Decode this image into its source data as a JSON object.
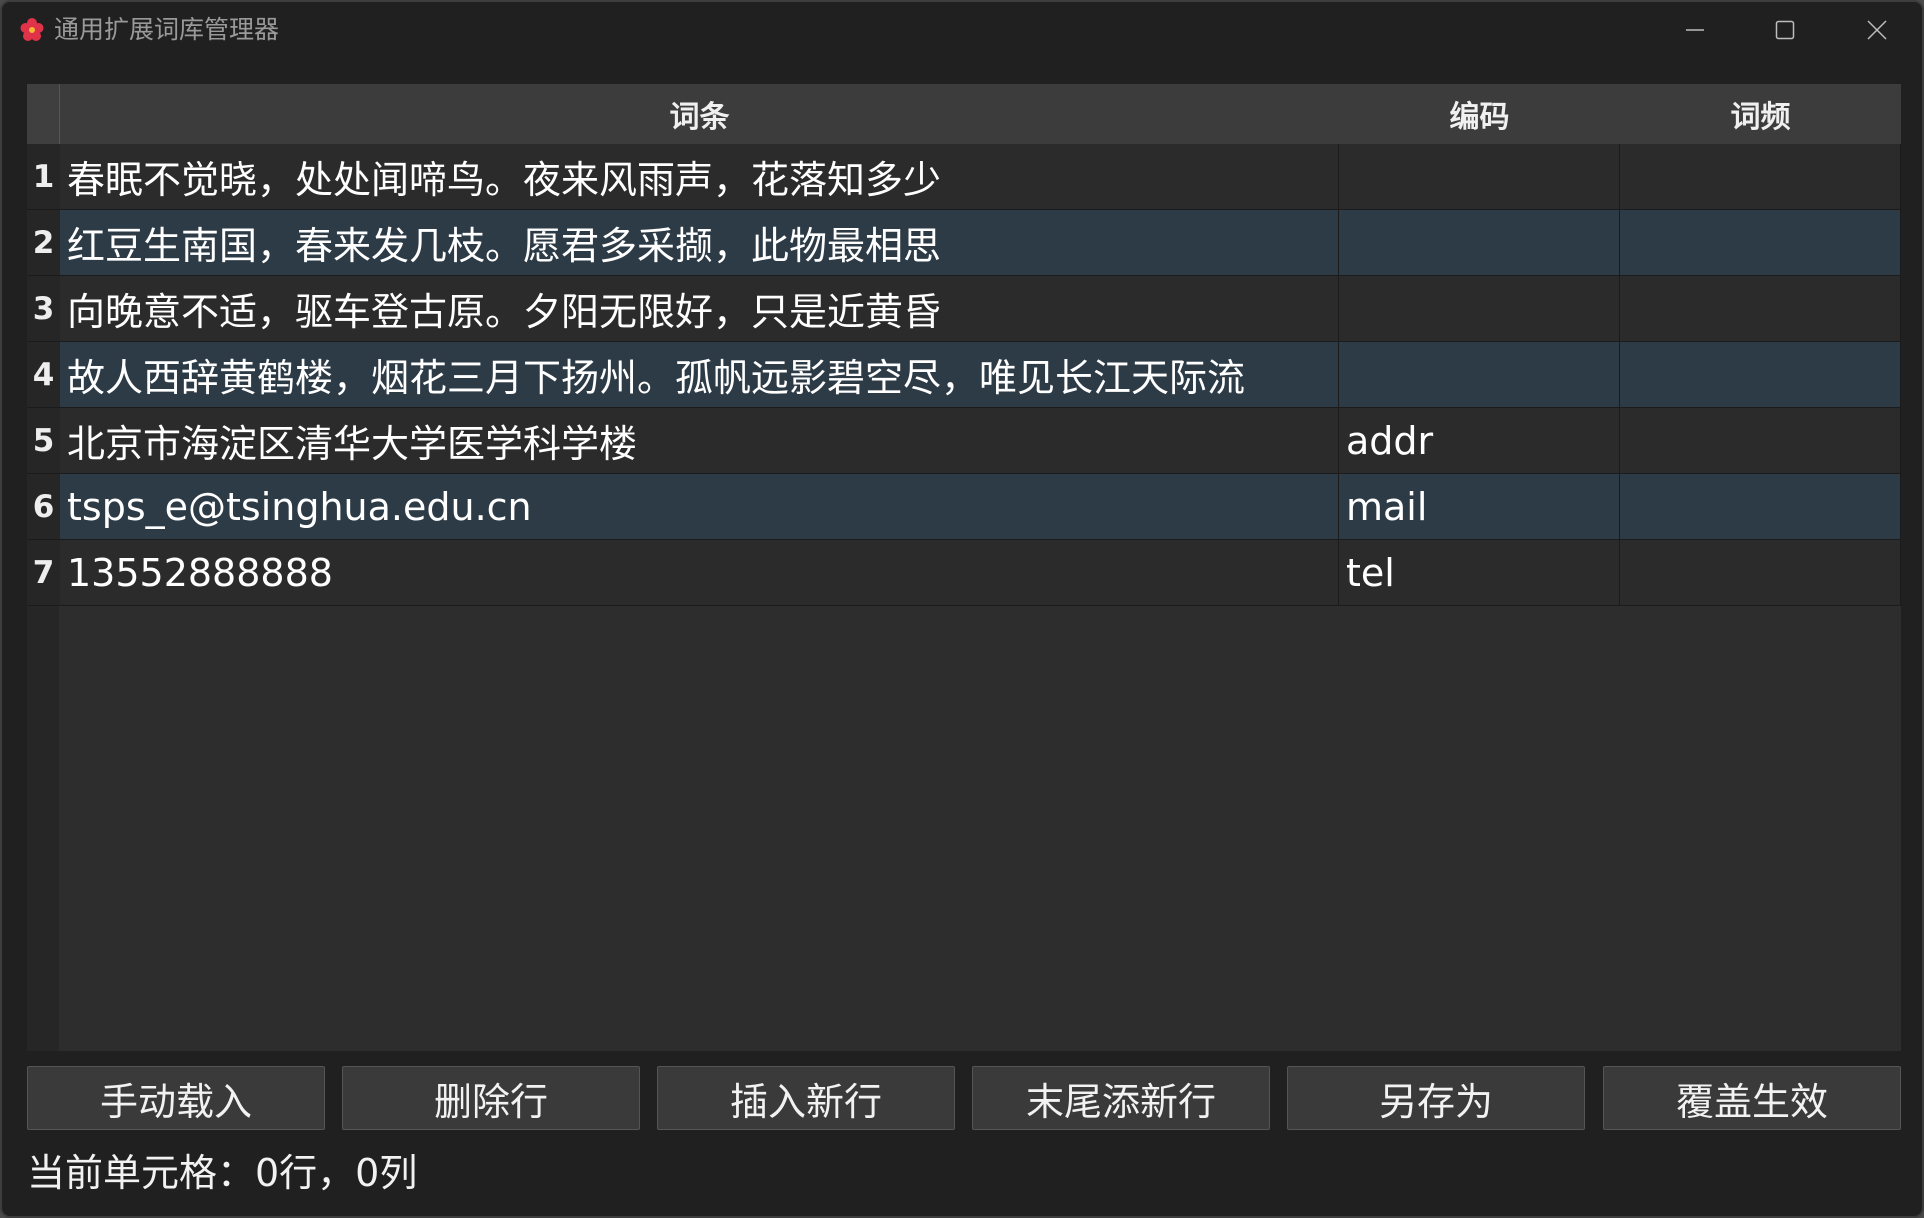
{
  "window": {
    "title": "通用扩展词库管理器"
  },
  "table": {
    "columns": [
      "词条",
      "编码",
      "词频"
    ],
    "rows": [
      {
        "num": "1",
        "term": "春眠不觉晓，处处闻啼鸟。夜来风雨声，花落知多少",
        "code": "",
        "freq": ""
      },
      {
        "num": "2",
        "term": "红豆生南国，春来发几枝。愿君多采撷，此物最相思",
        "code": "",
        "freq": ""
      },
      {
        "num": "3",
        "term": "向晚意不适，驱车登古原。夕阳无限好，只是近黄昏",
        "code": "",
        "freq": ""
      },
      {
        "num": "4",
        "term": "故人西辞黄鹤楼，烟花三月下扬州。孤帆远影碧空尽，唯见长江天际流",
        "code": "",
        "freq": ""
      },
      {
        "num": "5",
        "term": "北京市海淀区清华大学医学科学楼",
        "code": "addr",
        "freq": ""
      },
      {
        "num": "6",
        "term": "tsps_e@tsinghua.edu.cn",
        "code": "mail",
        "freq": ""
      },
      {
        "num": "7",
        "term": "13552888888",
        "code": "tel",
        "freq": ""
      }
    ]
  },
  "buttons": {
    "load": "手动载入",
    "delete_row": "删除行",
    "insert_row": "插入新行",
    "append_row": "末尾添新行",
    "save_as": "另存为",
    "apply": "覆盖生效"
  },
  "status": {
    "text": "当前单元格：0行，0列"
  },
  "colors": {
    "window_bg": "#202020",
    "header_bg": "#3c3c3c",
    "row_alt_bg": "#2d3b47",
    "icon_red": "#e0334a"
  }
}
